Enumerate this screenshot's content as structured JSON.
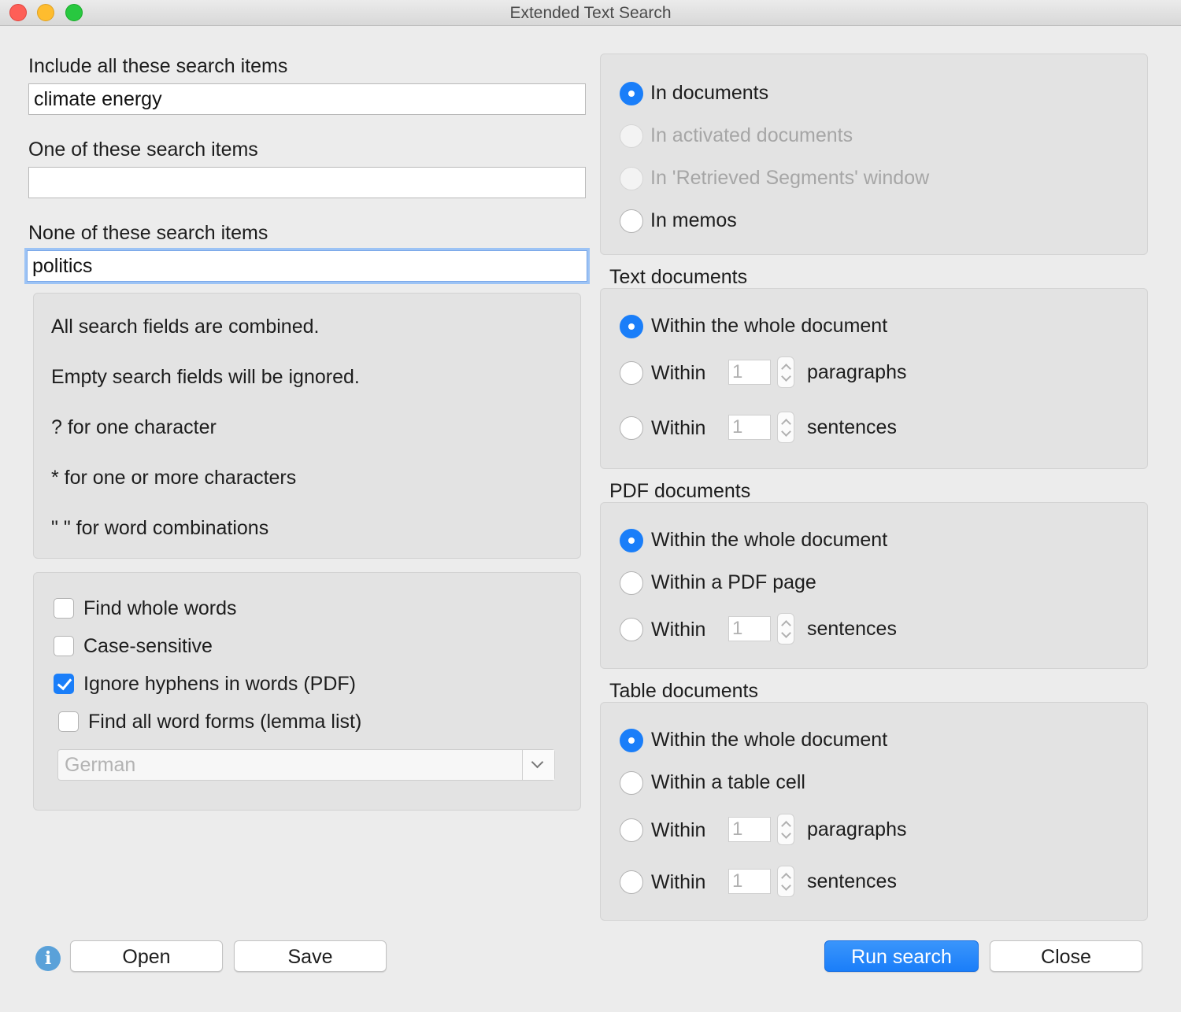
{
  "window": {
    "title": "Extended Text Search"
  },
  "search": {
    "include_label": "Include all these search items",
    "include_value": "climate energy",
    "one_label": "One of these search items",
    "one_value": "",
    "none_label": "None of these search items",
    "none_value": "politics"
  },
  "hints": [
    "All search fields are combined.",
    "Empty search fields will be ignored.",
    "?  for one character",
    "*  for one or more characters",
    "\" \"  for word combinations"
  ],
  "options": {
    "find_whole_words": {
      "label": "Find whole words",
      "checked": false
    },
    "case_sensitive": {
      "label": "Case-sensitive",
      "checked": false
    },
    "ignore_hyphens": {
      "label": "Ignore hyphens in words (PDF)",
      "checked": true
    },
    "find_word_forms": {
      "label": "Find all word forms (lemma list)",
      "checked": false
    },
    "lemma_language": "German"
  },
  "scope": {
    "in_documents": "In documents",
    "in_activated": "In activated documents",
    "in_retrieved": "In 'Retrieved Segments' window",
    "in_memos": "In memos",
    "selected": "in_documents"
  },
  "text_documents": {
    "title": "Text documents",
    "whole": "Within the whole document",
    "within": "Within",
    "paragraphs_value": "1",
    "paragraphs_unit": "paragraphs",
    "sentences_value": "1",
    "sentences_unit": "sentences"
  },
  "pdf_documents": {
    "title": "PDF documents",
    "whole": "Within the whole document",
    "page": "Within a PDF page",
    "within": "Within",
    "sentences_value": "1",
    "sentences_unit": "sentences"
  },
  "table_documents": {
    "title": "Table documents",
    "whole": "Within the whole document",
    "cell": "Within a table cell",
    "within": "Within",
    "paragraphs_value": "1",
    "paragraphs_unit": "paragraphs",
    "sentences_value": "1",
    "sentences_unit": "sentences"
  },
  "buttons": {
    "info": "i",
    "open": "Open",
    "save": "Save",
    "run": "Run search",
    "close": "Close"
  },
  "colors": {
    "accent": "#1a7ef9",
    "background": "#ececec",
    "panel": "#e3e3e3"
  }
}
